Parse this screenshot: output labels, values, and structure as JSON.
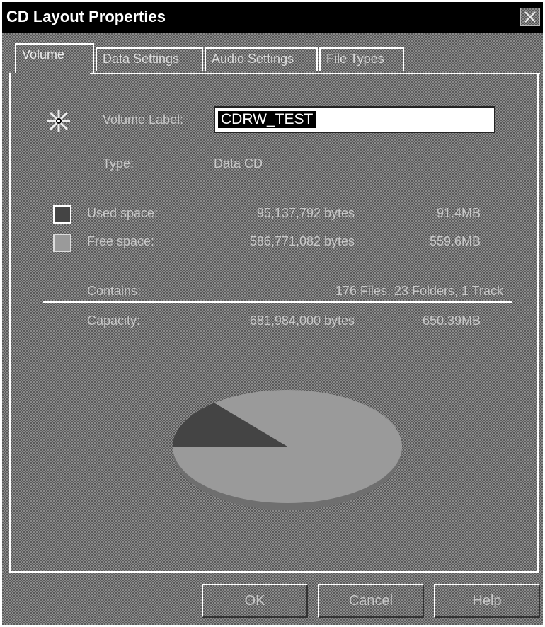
{
  "window": {
    "title": "CD Layout Properties"
  },
  "tabs": [
    {
      "label": "Volume",
      "active": true
    },
    {
      "label": "Data Settings",
      "active": false
    },
    {
      "label": "Audio Settings",
      "active": false
    },
    {
      "label": "File Types",
      "active": false
    }
  ],
  "volume": {
    "label_caption": "Volume Label:",
    "label_value": "CDRW_TEST",
    "type_caption": "Type:",
    "type_value": "Data CD"
  },
  "space": {
    "used": {
      "caption": "Used space:",
      "bytes": "95,137,792 bytes",
      "size": "91.4MB"
    },
    "free": {
      "caption": "Free space:",
      "bytes": "586,771,082 bytes",
      "size": "559.6MB"
    },
    "contains_caption": "Contains:",
    "contains_value": "176 Files, 23 Folders, 1 Track",
    "capacity_caption": "Capacity:",
    "capacity_bytes": "681,984,000 bytes",
    "capacity_size": "650.39MB"
  },
  "usage_chart": {
    "used_fraction": 0.14,
    "used_color": "#444444",
    "free_color": "#9a9a9a"
  },
  "buttons": {
    "ok": "OK",
    "cancel": "Cancel",
    "help": "Help"
  },
  "icons": {
    "close": "close-icon",
    "cd": "cd-disc-icon"
  }
}
